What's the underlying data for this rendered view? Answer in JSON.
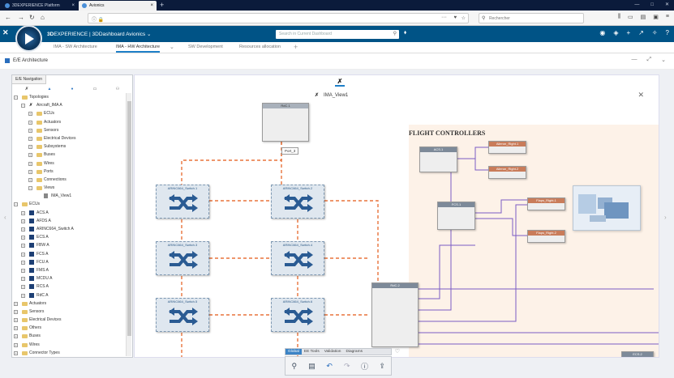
{
  "browser": {
    "tabs": [
      {
        "label": "3DEXPERIENCE Platform",
        "active": false
      },
      {
        "label": "Avionics",
        "active": true
      }
    ],
    "new_tab": "+",
    "search_placeholder": "Rechercher"
  },
  "app": {
    "brand": "3D",
    "title_bold": "3D",
    "title_rest": "EXPERIENCE | 3DDashboard  Avionics",
    "search_placeholder": "Search in Current Dashboard"
  },
  "dashboard_tabs": [
    {
      "label": "IMA - SW Architecture",
      "active": false
    },
    {
      "label": "IMA - HW Architecture",
      "active": true
    },
    {
      "label": "SW Development",
      "active": false
    },
    {
      "label": "Resources allocation",
      "active": false
    }
  ],
  "widget": {
    "title": "E/E Architecture"
  },
  "nav_panel": {
    "tab_label": "E/E Navigation",
    "tree": [
      {
        "label": "Topologies",
        "depth": 0,
        "kind": "folder",
        "expand": "−"
      },
      {
        "label": "Aircraft_IMA A",
        "depth": 1,
        "kind": "logo",
        "expand": "−"
      },
      {
        "label": "ECUs",
        "depth": 2,
        "kind": "folder",
        "expand": "+"
      },
      {
        "label": "Actuators",
        "depth": 2,
        "kind": "folder",
        "expand": "+"
      },
      {
        "label": "Sensors",
        "depth": 2,
        "kind": "folder",
        "expand": "+"
      },
      {
        "label": "Electrical Devices",
        "depth": 2,
        "kind": "folder",
        "expand": "+"
      },
      {
        "label": "Subsystems",
        "depth": 2,
        "kind": "folder",
        "expand": "+"
      },
      {
        "label": "Buses",
        "depth": 2,
        "kind": "folder",
        "expand": "+"
      },
      {
        "label": "Wires",
        "depth": 2,
        "kind": "folder",
        "expand": "+"
      },
      {
        "label": "Ports",
        "depth": 2,
        "kind": "folder",
        "expand": "+"
      },
      {
        "label": "Connections",
        "depth": 2,
        "kind": "folder",
        "expand": "+"
      },
      {
        "label": "Views",
        "depth": 2,
        "kind": "folder",
        "expand": "−"
      },
      {
        "label": "IMA_View1",
        "depth": 3,
        "kind": "view",
        "expand": ""
      },
      {
        "label": "ECUs",
        "depth": 0,
        "kind": "folder",
        "expand": "−"
      },
      {
        "label": "ACS A",
        "depth": 1,
        "kind": "ecu",
        "expand": "+"
      },
      {
        "label": "AFDS A",
        "depth": 1,
        "kind": "ecu",
        "expand": "+"
      },
      {
        "label": "ARINC664_Switch A",
        "depth": 1,
        "kind": "ecu",
        "expand": "+"
      },
      {
        "label": "ECS A",
        "depth": 1,
        "kind": "ecu",
        "expand": "+"
      },
      {
        "label": "FBW A",
        "depth": 1,
        "kind": "ecu",
        "expand": "+"
      },
      {
        "label": "FCS A",
        "depth": 1,
        "kind": "ecu",
        "expand": "+"
      },
      {
        "label": "FCU A",
        "depth": 1,
        "kind": "ecu",
        "expand": "+"
      },
      {
        "label": "FMS A",
        "depth": 1,
        "kind": "ecu",
        "expand": "+"
      },
      {
        "label": "MCDU A",
        "depth": 1,
        "kind": "ecu",
        "expand": "+"
      },
      {
        "label": "RCS A",
        "depth": 1,
        "kind": "ecu",
        "expand": "+"
      },
      {
        "label": "RdC A",
        "depth": 1,
        "kind": "ecu",
        "expand": "+"
      },
      {
        "label": "Actuators",
        "depth": 0,
        "kind": "folder",
        "expand": "+"
      },
      {
        "label": "Sensors",
        "depth": 0,
        "kind": "folder",
        "expand": "+"
      },
      {
        "label": "Electrical Devices",
        "depth": 0,
        "kind": "folder",
        "expand": "+"
      },
      {
        "label": "Others",
        "depth": 0,
        "kind": "folder",
        "expand": "+"
      },
      {
        "label": "Buses",
        "depth": 0,
        "kind": "folder",
        "expand": "+"
      },
      {
        "label": "Wires",
        "depth": 0,
        "kind": "folder",
        "expand": "+"
      },
      {
        "label": "Connector Types",
        "depth": 0,
        "kind": "folder",
        "expand": "+"
      }
    ]
  },
  "diagram": {
    "view_name": "IMA_View1",
    "region_title": "FLIGHT CONTROLLERS",
    "port_label": "Port_3",
    "boxes": {
      "rdc1": "RdC.1",
      "acs1": "ACS.1",
      "fcs1": "FCS.1",
      "rdc2": "RdC.2",
      "aileron_right1": "Aileron_Right.1",
      "aileron_right2": "Aileron_Right.2",
      "flaps_right1": "Flaps_Right.1",
      "flaps_right2": "Flaps_Right.2",
      "ecs2": "ECS.2"
    },
    "switches": [
      "ARINC664_Switch.1",
      "ARINC664_Switch.2",
      "ARINC664_Switch.3",
      "ARINC664_Switch.4",
      "ARINC664_Switch.5",
      "ARINC664_Switch.6"
    ],
    "colors": {
      "bus_line": "#e8733b",
      "link_line": "#7a5cc4",
      "region_bg": "#fdf2e8"
    }
  },
  "bottom_toolbar": {
    "tabs": [
      {
        "label": "Global",
        "active": true
      },
      {
        "label": "EE Tools",
        "active": false
      },
      {
        "label": "Validation",
        "active": false
      },
      {
        "label": "Diagrams",
        "active": false
      }
    ],
    "icons": [
      "zoom-icon",
      "document-icon",
      "undo-icon",
      "redo-icon",
      "info-icon",
      "export-icon"
    ]
  }
}
